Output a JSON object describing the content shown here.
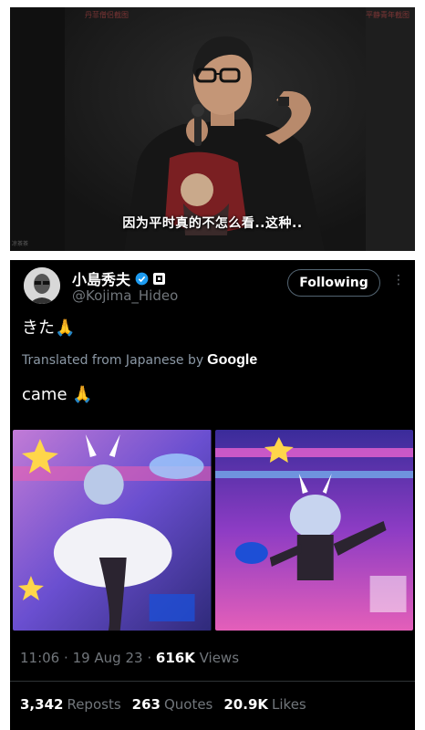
{
  "video": {
    "watermark_left": "丹菲僧侣截图",
    "watermark_right": "平静青年截图",
    "corner_text": "凉茶茶",
    "subtitle": "因为平时真的不怎么看..这种.."
  },
  "tweet": {
    "display_name": "小島秀夫",
    "handle": "@Kojima_Hideo",
    "follow_label": "Following",
    "more_label": "⋮",
    "original_text": "きた🙏",
    "translated_prefix": "Translated from Japanese by",
    "translated_by": "Google",
    "translation": "came 🙏",
    "meta": {
      "time": "11:06",
      "date": "19 Aug 23",
      "views_count": "616K",
      "views_label": "Views"
    },
    "stats": {
      "reposts_count": "3,342",
      "reposts_label": "Reposts",
      "quotes_count": "263",
      "quotes_label": "Quotes",
      "likes_count": "20.9K",
      "likes_label": "Likes"
    }
  },
  "colors": {
    "verified_blue": "#1d9bf0",
    "background": "#000000",
    "muted": "#71767b"
  }
}
